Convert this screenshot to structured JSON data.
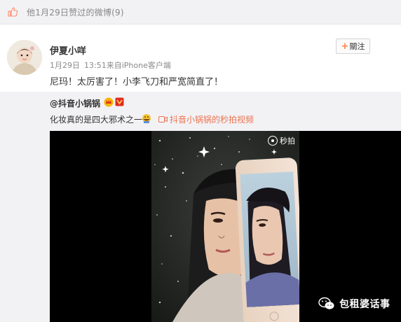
{
  "like_bar": {
    "text": "他1月29日赞过的微博(9)"
  },
  "post": {
    "username": "伊夏小咩",
    "date": "1月29日",
    "time": "13:51",
    "source": "来自iPhone客户端",
    "text": "尼玛！太厉害了！小李飞刀和严宽简直了！",
    "follow_label": "關注"
  },
  "repost": {
    "author": "@抖音小锅锅",
    "text": "化妆真的是四大邪术之一",
    "link_text": "抖音小锅锅的秒拍视频",
    "link_color": "#eb7350"
  },
  "video": {
    "watermark": "秒拍"
  },
  "wechat_watermark": "包租婆话事",
  "colors": {
    "like_bar_bg": "#f2f2f5",
    "repost_bg": "#f2f2f5",
    "follow_plus": "#ff8140"
  },
  "icons": [
    "thumbs-up-icon",
    "plus-icon",
    "crown-badge-icon",
    "vip-badge-icon",
    "grin-emoji-icon",
    "video-link-icon",
    "miaopai-logo-icon",
    "wechat-icon"
  ]
}
